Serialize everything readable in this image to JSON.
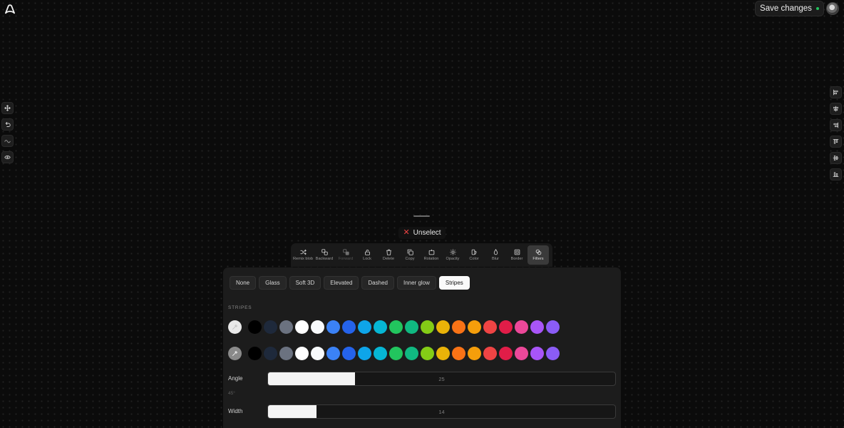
{
  "header": {
    "logo_icon": "cloud-logo-icon",
    "save_label": "Save changes",
    "save_status_color": "#22c55e",
    "avatar_icon": "user-avatar"
  },
  "left_tools": [
    {
      "name": "move-tool",
      "icon": "move-icon"
    },
    {
      "name": "undo-tool",
      "icon": "undo-icon"
    },
    {
      "name": "wave-tool",
      "icon": "wave-icon"
    },
    {
      "name": "preview-tool",
      "icon": "eye-icon"
    }
  ],
  "right_tools": [
    {
      "name": "align-left-tool",
      "icon": "align-left-icon"
    },
    {
      "name": "align-center-h-tool",
      "icon": "align-center-horizontal-icon"
    },
    {
      "name": "align-right-tool",
      "icon": "align-right-icon"
    },
    {
      "name": "align-top-tool",
      "icon": "align-top-icon"
    },
    {
      "name": "align-center-v-tool",
      "icon": "align-center-vertical-icon"
    },
    {
      "name": "align-bottom-tool",
      "icon": "align-bottom-icon"
    }
  ],
  "unselect_label": "Unselect",
  "toolbar": {
    "items": [
      {
        "label": "Remix blob",
        "icon": "shuffle-icon"
      },
      {
        "label": "Backward",
        "icon": "send-backward-icon"
      },
      {
        "label": "Forward",
        "icon": "bring-forward-icon",
        "disabled": true
      },
      {
        "label": "Lock",
        "icon": "lock-icon"
      },
      {
        "label": "Delete",
        "icon": "trash-icon"
      },
      {
        "label": "Copy",
        "icon": "copy-icon"
      },
      {
        "label": "Rotation",
        "icon": "rotate-icon"
      },
      {
        "label": "Opacity",
        "icon": "sun-icon"
      },
      {
        "label": "Color",
        "icon": "color-icon"
      },
      {
        "label": "Blur",
        "icon": "blur-icon"
      },
      {
        "label": "Border",
        "icon": "border-icon"
      },
      {
        "label": "Filters",
        "icon": "filters-icon",
        "active": true
      }
    ]
  },
  "panel": {
    "presets": [
      "None",
      "Glass",
      "Soft 3D",
      "Elevated",
      "Dashed",
      "Inner glow",
      "Stripes"
    ],
    "active_preset": "Stripes",
    "section_title": "STRIPES",
    "swatches": [
      "#000000",
      "#1e293b",
      "#6b7280",
      "#ffffff",
      "#f8fafc",
      "#3b82f6",
      "#2563eb",
      "#0ea5e9",
      "#06b6d4",
      "#22c55e",
      "#10b981",
      "#84cc16",
      "#eab308",
      "#f97316",
      "#f59e0b",
      "#ef4444",
      "#e11d48",
      "#ec4899",
      "#a855f7",
      "#8b5cf6"
    ],
    "angle": {
      "label": "Angle",
      "value": "25",
      "sub": "45°",
      "fraction": 0.25
    },
    "width": {
      "label": "Width",
      "value": "14",
      "fraction": 0.14
    }
  }
}
